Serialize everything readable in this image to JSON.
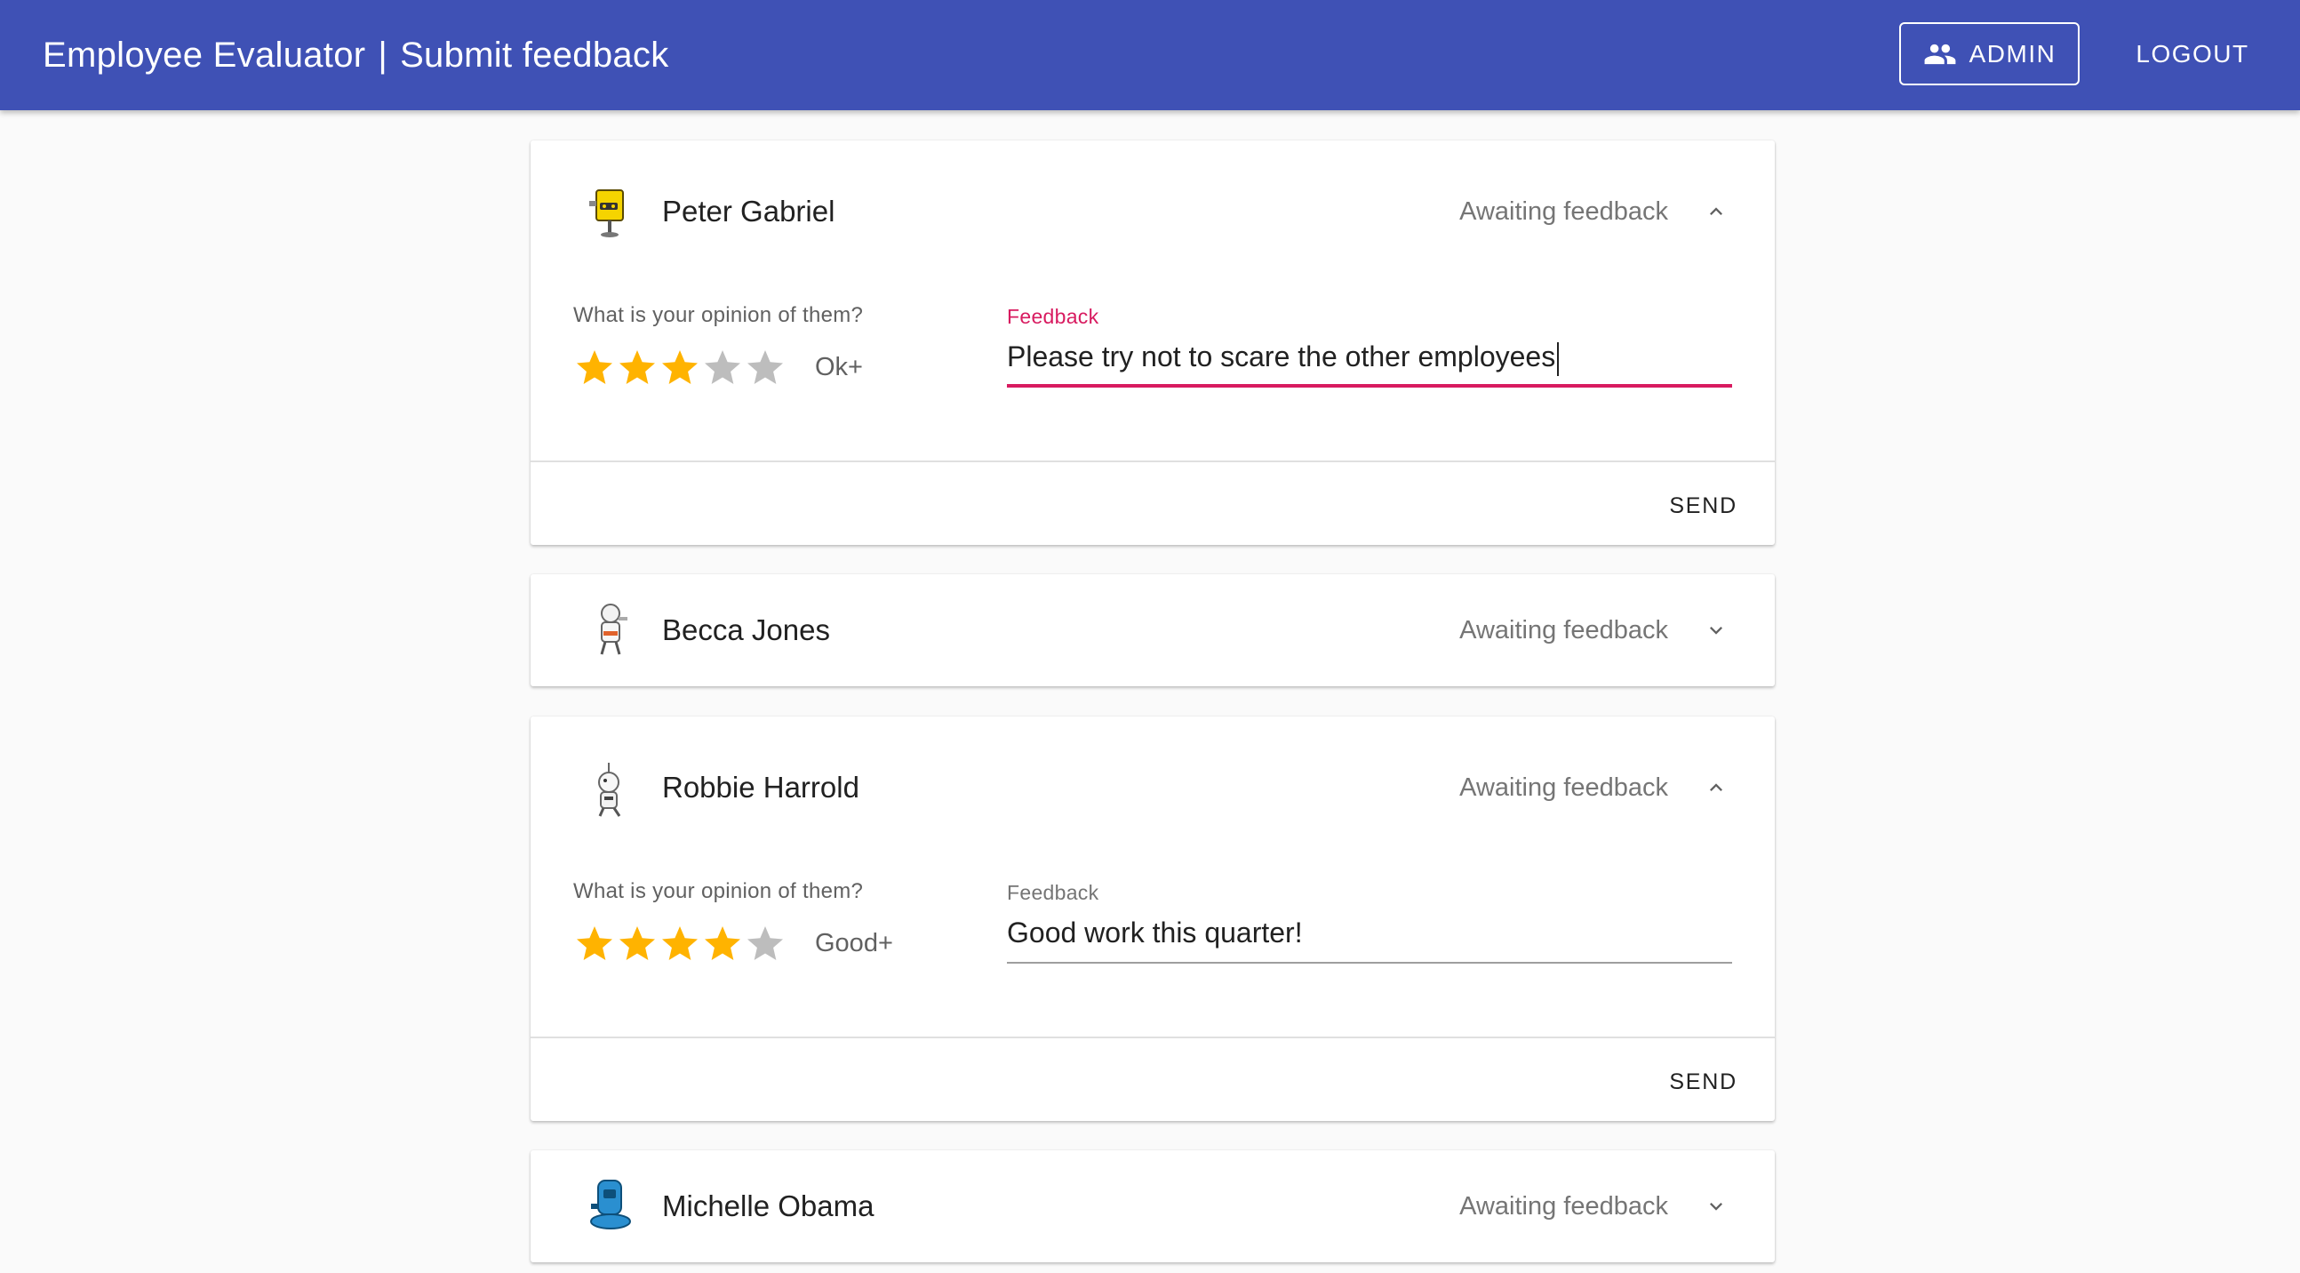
{
  "appbar": {
    "app_name": "Employee Evaluator",
    "separator": "|",
    "page_title": "Submit feedback",
    "admin_label": "ADMIN",
    "admin_icon": "people-icon",
    "logout_label": "LOGOUT",
    "bar_color": "#3f51b5"
  },
  "form": {
    "opinion_label": "What is your opinion of them?",
    "feedback_label": "Feedback",
    "send_label": "SEND",
    "status_text": "Awaiting feedback"
  },
  "colors": {
    "star_on": "#ffb300",
    "star_off": "#bdbdbd",
    "focus_accent": "#d81b60"
  },
  "employees": [
    {
      "name": "Peter Gabriel",
      "status": "Awaiting feedback",
      "expanded": true,
      "rating": 3,
      "rating_max": 5,
      "rating_text": "Ok+",
      "feedback": "Please try not to scare the other employees",
      "focused": true,
      "avatar": "yellow-robot-icon"
    },
    {
      "name": "Becca Jones",
      "status": "Awaiting feedback",
      "expanded": false,
      "avatar": "white-robot-icon"
    },
    {
      "name": "Robbie Harrold",
      "status": "Awaiting feedback",
      "expanded": true,
      "rating": 4,
      "rating_max": 5,
      "rating_text": "Good+",
      "feedback": "Good work this quarter!",
      "focused": false,
      "avatar": "antenna-robot-icon"
    },
    {
      "name": "Michelle Obama",
      "status": "Awaiting feedback",
      "expanded": false,
      "avatar": "blue-robot-icon"
    }
  ]
}
